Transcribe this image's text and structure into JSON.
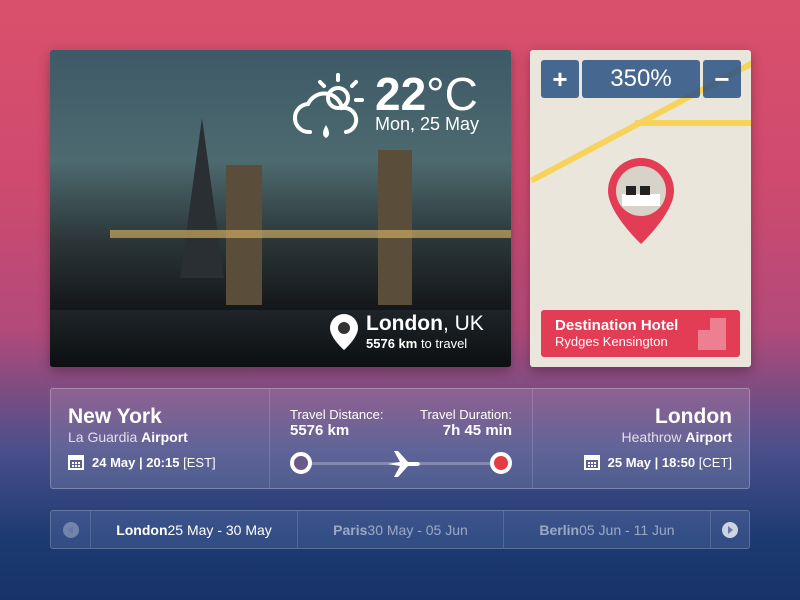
{
  "weather": {
    "icon": "cloud-sun-rain-icon",
    "temperature": "22",
    "unit": "°C",
    "date": "Mon, 25 May"
  },
  "location": {
    "city": "London",
    "country": ", UK",
    "distance": "5576 km",
    "distance_suffix": " to travel"
  },
  "map": {
    "zoom_in": "+",
    "zoom_level": "350%",
    "zoom_out": "−",
    "hotel_title": "Destination Hotel",
    "hotel_name": "Rydges Kensington",
    "accent": "#e33c55"
  },
  "flight": {
    "origin": {
      "city": "New York",
      "airport_name": "La Guardia ",
      "airport_word": "Airport",
      "date": "24 May | 20:15",
      "tz": "[EST]"
    },
    "distance_label": "Travel Distance:",
    "distance_value": "5576 km",
    "duration_label": "Travel Duration:",
    "duration_value": "7h 45 min",
    "destination": {
      "city": "London",
      "airport_name": "Heathrow ",
      "airport_word": "Airport",
      "date": "25 May | 18:50",
      "tz": "[CET]"
    }
  },
  "itinerary": [
    {
      "city": "London",
      "dates": " 25 May - 30 May",
      "active": true
    },
    {
      "city": "Paris",
      "dates": " 30 May - 05 Jun",
      "active": false
    },
    {
      "city": "Berlin",
      "dates": " 05 Jun - 11 Jun",
      "active": false
    }
  ]
}
